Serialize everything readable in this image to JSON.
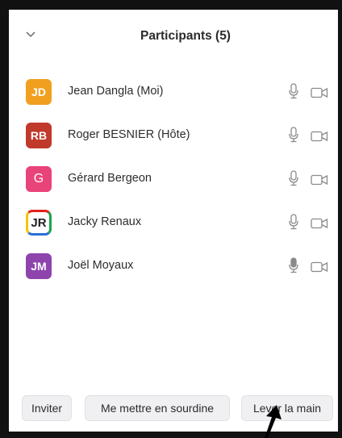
{
  "header": {
    "title": "Participants (5)",
    "collapse_icon": "chevron-down-icon"
  },
  "participants": [
    {
      "initials": "JD",
      "name": "Jean Dangla (Moi)",
      "avatar_color": "#f0a01e",
      "mic_icon": "microphone-icon",
      "cam_icon": "video-camera-off-icon"
    },
    {
      "initials": "RB",
      "name": "Roger BESNIER (Hôte)",
      "avatar_color": "#c0392b",
      "mic_icon": "microphone-icon",
      "cam_icon": "video-camera-off-icon"
    },
    {
      "initials": "G",
      "name": "Gérard Bergeon",
      "avatar_color": "#e9447a",
      "mic_icon": "microphone-icon",
      "cam_icon": "video-camera-off-icon"
    },
    {
      "initials": "JR",
      "name": "Jacky Renaux",
      "avatar_color": "#ffffff",
      "mic_icon": "microphone-icon",
      "cam_icon": "video-camera-off-icon"
    },
    {
      "initials": "JM",
      "name": "Joël Moyaux",
      "avatar_color": "#8e44ad",
      "mic_icon": "microphone-active-icon",
      "cam_icon": "video-camera-off-icon"
    }
  ],
  "footer": {
    "invite_label": "Inviter",
    "mute_label": "Me mettre en sourdine",
    "raise_hand_label": "Lever la main"
  },
  "annotation": {
    "icon": "arrow-pointer-icon",
    "color": "#000000"
  }
}
